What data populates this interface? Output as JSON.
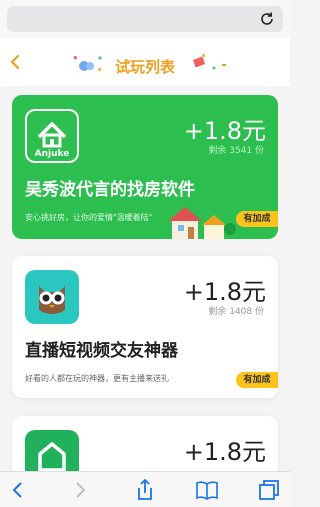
{
  "browser": {
    "reload_icon": "reload-icon"
  },
  "header": {
    "title": "试玩列表",
    "back_icon": "chevron-left-icon"
  },
  "cards": [
    {
      "icon_label": "Anjuke",
      "price": "+1.8元",
      "remaining": "剩余 3541 份",
      "name": "吴秀波代言的找房软件",
      "desc": "安心挑好房，让你的爱情\"温暖着陆\"",
      "badge": "有加成",
      "bg_color": "#2cbe4e"
    },
    {
      "price": "+1.8元",
      "remaining": "剩余 1408 份",
      "name": "直播短视频交友神器",
      "desc": "好看的人都在玩的神器，更有主播来送礼",
      "badge": "有加成"
    },
    {
      "price": "+1.8元"
    }
  ],
  "toolbar": {
    "items": [
      "back-icon",
      "forward-icon",
      "share-icon",
      "bookmarks-icon",
      "tabs-icon"
    ]
  },
  "colors": {
    "accent": "#f0a020",
    "green": "#2cbe4e",
    "badge": "#fcc31b"
  }
}
